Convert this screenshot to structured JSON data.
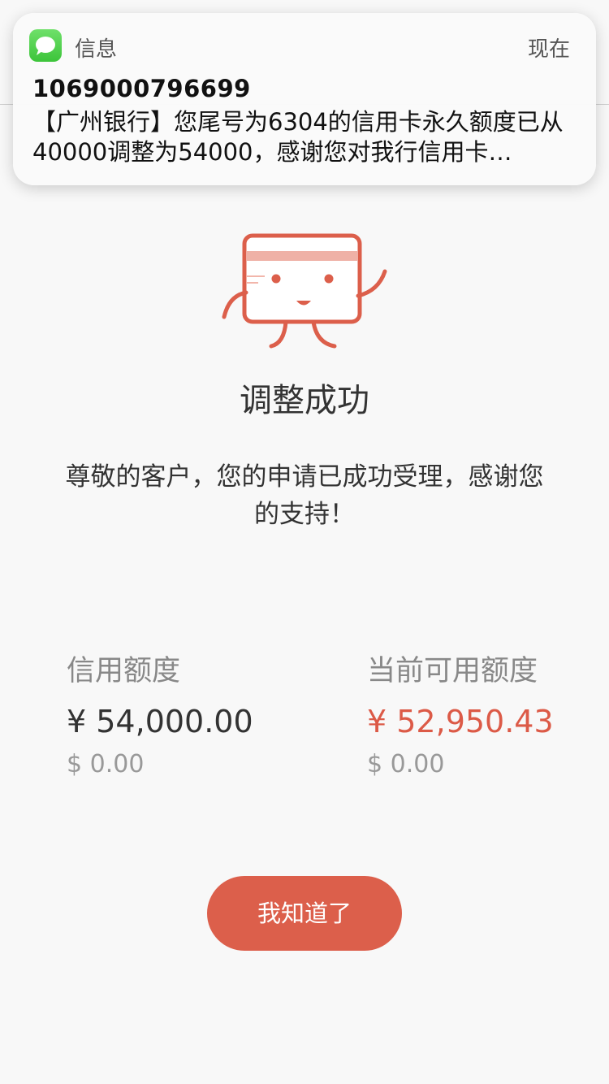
{
  "notification": {
    "app_name": "信息",
    "time": "现在",
    "sender": "1069000796699",
    "body": "【广州银行】您尾号为6304的信用卡永久额度已从40000调整为54000，感谢您对我行信用卡…",
    "icon": "messages-icon"
  },
  "result": {
    "title": "调整成功",
    "message": "尊敬的客户，您的申请已成功受理，感谢您的支持！",
    "mascot": "credit-card-mascot-icon"
  },
  "limits": {
    "credit": {
      "label": "信用额度",
      "amount": "¥ 54,000.00",
      "usd": "$ 0.00"
    },
    "available": {
      "label": "当前可用额度",
      "amount": "¥ 52,950.43",
      "usd": "$ 0.00"
    }
  },
  "button": {
    "label": "我知道了"
  },
  "colors": {
    "accent": "#dc5f4b",
    "available_amount": "#dc5a47",
    "background": "#f8f8f8"
  }
}
